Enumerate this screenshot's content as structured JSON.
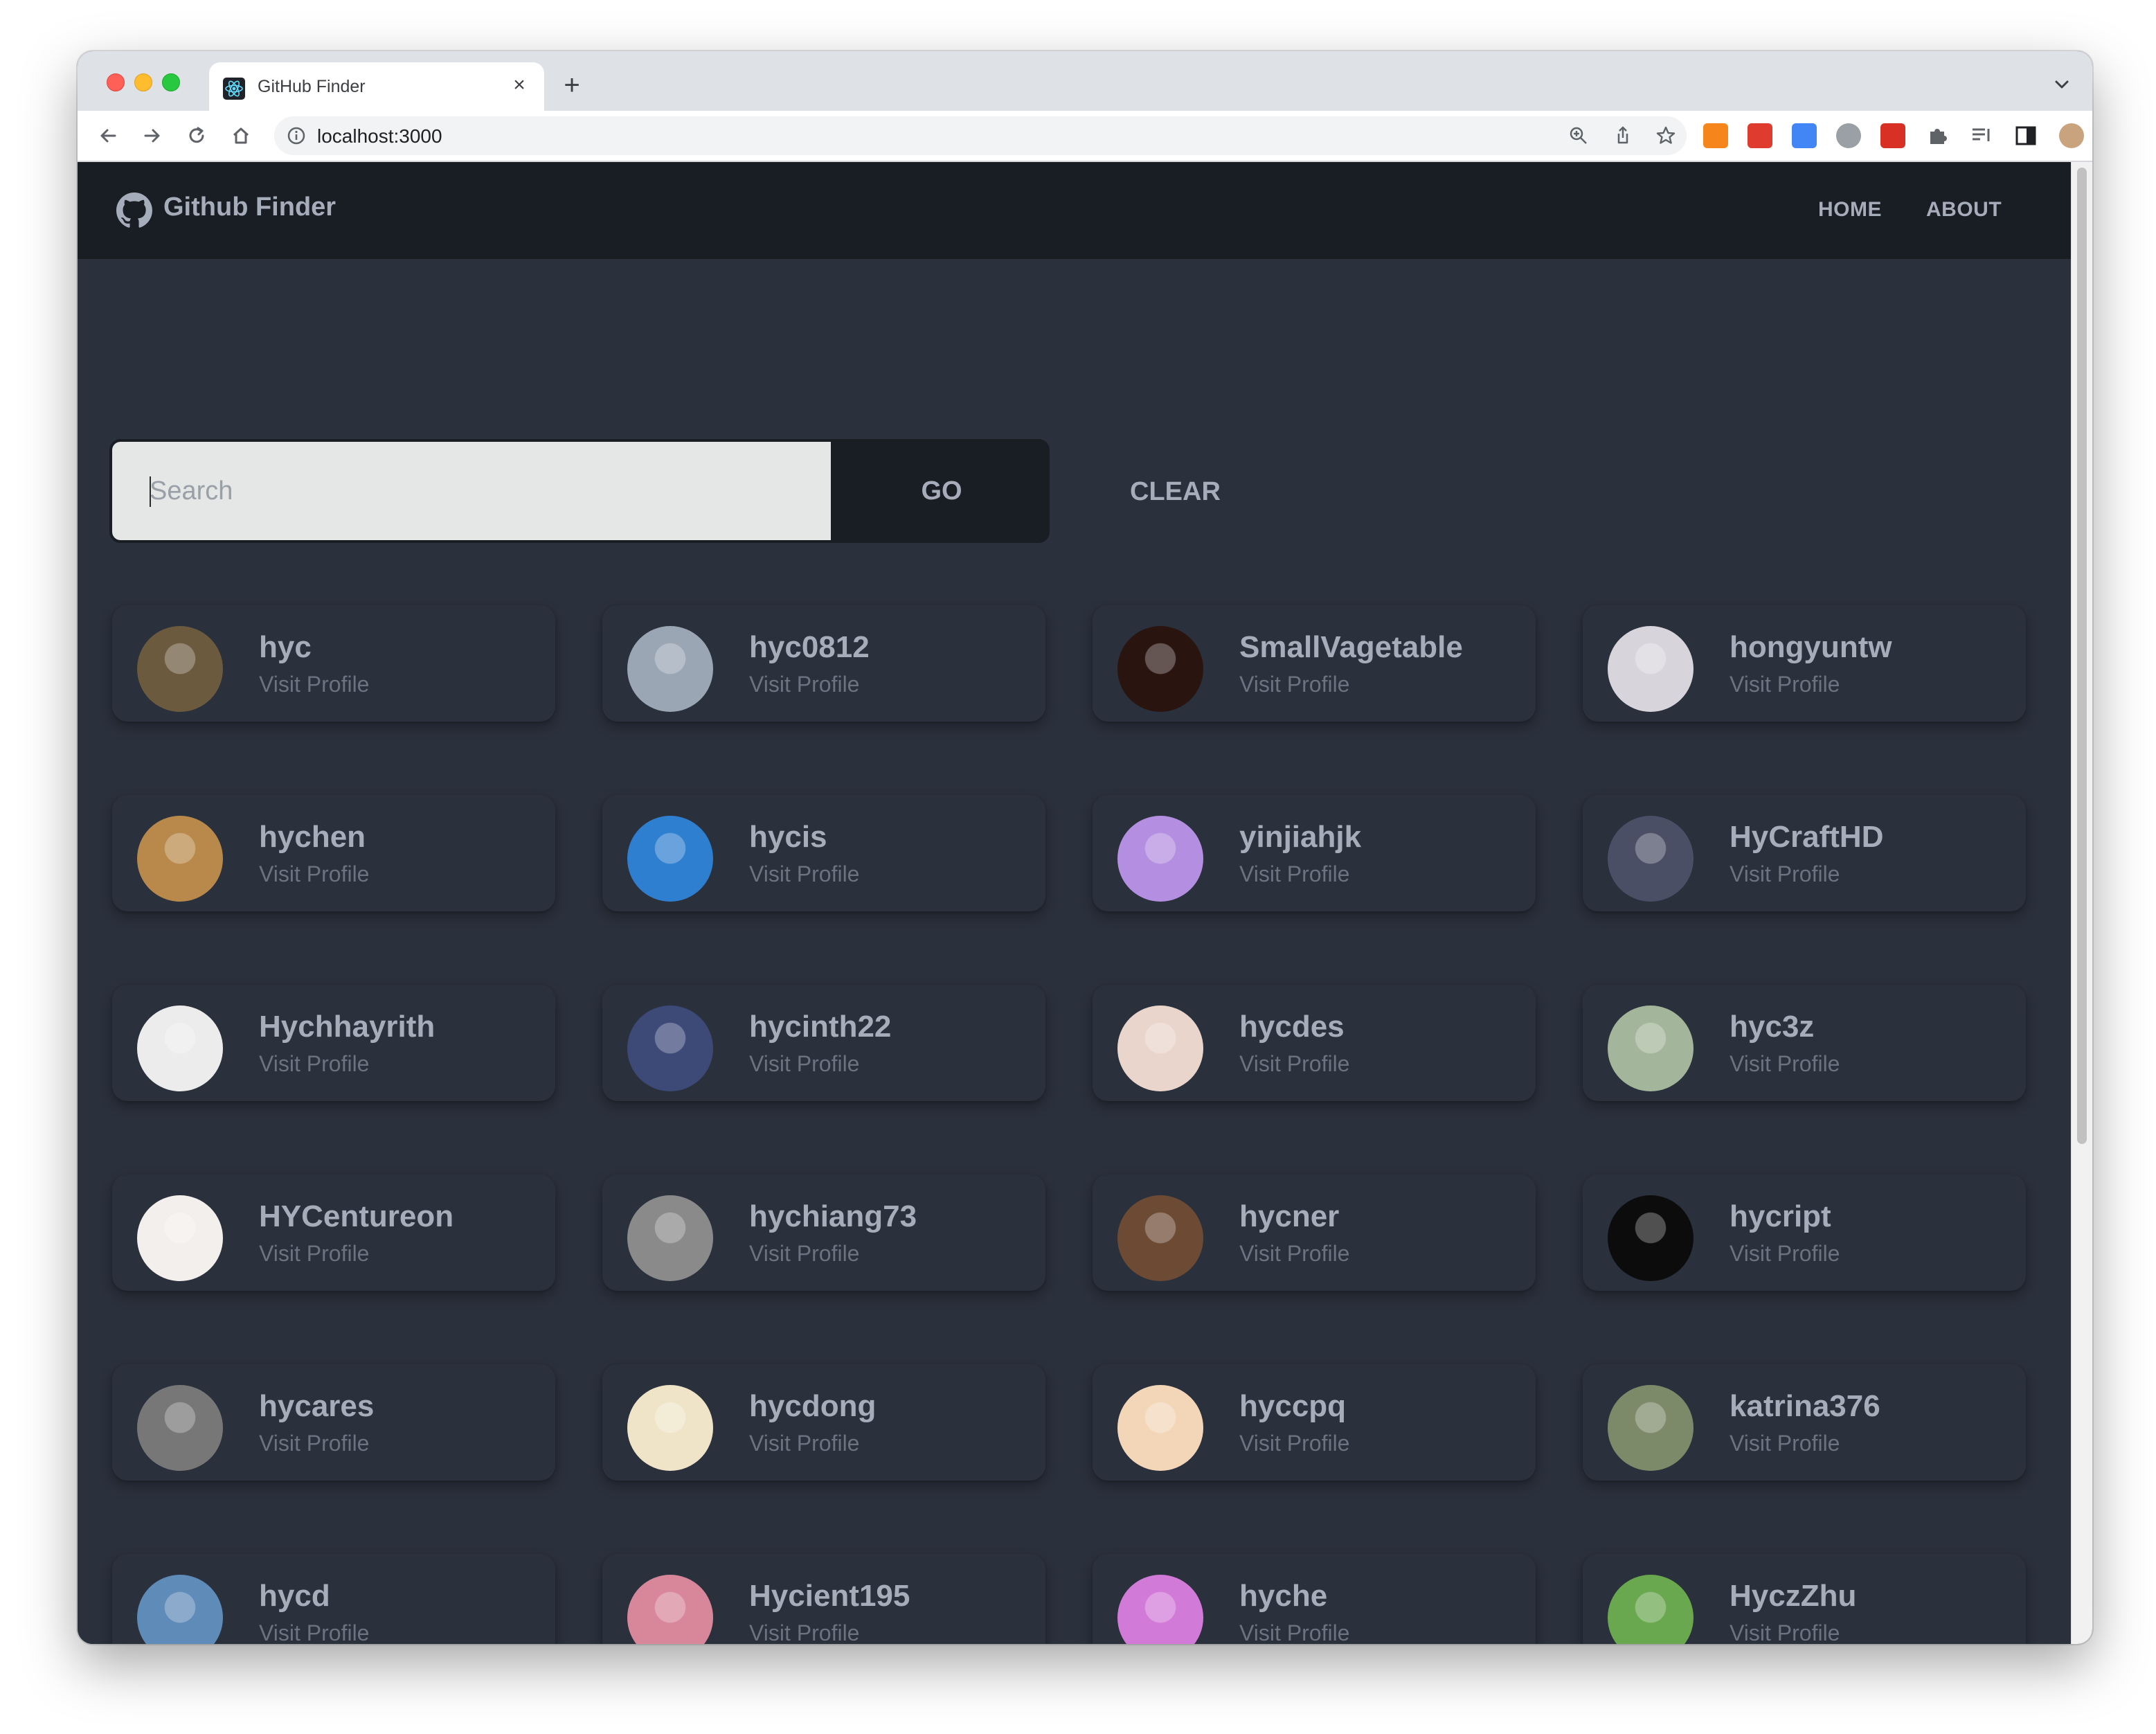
{
  "browser": {
    "tab_title": "GitHub Finder",
    "url": "localhost:3000",
    "new_tab_symbol": "+",
    "close_symbol": "×"
  },
  "navbar": {
    "brand": "Github Finder",
    "links": [
      "HOME",
      "ABOUT"
    ]
  },
  "search": {
    "placeholder": "Search",
    "value": "",
    "go_label": "GO",
    "clear_label": "CLEAR"
  },
  "users": [
    {
      "login": "hyc",
      "link": "Visit Profile",
      "avatar_color": "#6b5a3e"
    },
    {
      "login": "hyc0812",
      "link": "Visit Profile",
      "avatar_color": "#9aa6b4"
    },
    {
      "login": "SmallVagetable",
      "link": "Visit Profile",
      "avatar_color": "#2a1410"
    },
    {
      "login": "hongyuntw",
      "link": "Visit Profile",
      "avatar_color": "#d8d4dc"
    },
    {
      "login": "hychen",
      "link": "Visit Profile",
      "avatar_color": "#b8894a"
    },
    {
      "login": "hycis",
      "link": "Visit Profile",
      "avatar_color": "#2f7fd0"
    },
    {
      "login": "yinjiahjk",
      "link": "Visit Profile",
      "avatar_color": "#b48ee0"
    },
    {
      "login": "HyCraftHD",
      "link": "Visit Profile",
      "avatar_color": "#4a4f66"
    },
    {
      "login": "Hychhayrith",
      "link": "Visit Profile",
      "avatar_color": "#ececec"
    },
    {
      "login": "hycinth22",
      "link": "Visit Profile",
      "avatar_color": "#3d4a78"
    },
    {
      "login": "hycdes",
      "link": "Visit Profile",
      "avatar_color": "#e9d5cc"
    },
    {
      "login": "hyc3z",
      "link": "Visit Profile",
      "avatar_color": "#a3b59a"
    },
    {
      "login": "HYCentureon",
      "link": "Visit Profile",
      "avatar_color": "#f2efec"
    },
    {
      "login": "hychiang73",
      "link": "Visit Profile",
      "avatar_color": "#8a8a8a"
    },
    {
      "login": "hycner",
      "link": "Visit Profile",
      "avatar_color": "#6d4a34"
    },
    {
      "login": "hycript",
      "link": "Visit Profile",
      "avatar_color": "#0c0c0c"
    },
    {
      "login": "hycares",
      "link": "Visit Profile",
      "avatar_color": "#777777"
    },
    {
      "login": "hycdong",
      "link": "Visit Profile",
      "avatar_color": "#efe4c8"
    },
    {
      "login": "hyccpq",
      "link": "Visit Profile",
      "avatar_color": "#f3d6b8"
    },
    {
      "login": "katrina376",
      "link": "Visit Profile",
      "avatar_color": "#7c8a6a"
    },
    {
      "login": "hycd",
      "link": "Visit Profile",
      "avatar_color": "#5f8bb8"
    },
    {
      "login": "Hycient195",
      "link": "Visit Profile",
      "avatar_color": "#d8879a"
    },
    {
      "login": "hyche",
      "link": "Visit Profile",
      "avatar_color": "#d27ad8"
    },
    {
      "login": "HyczZhu",
      "link": "Visit Profile",
      "avatar_color": "#6aa84f"
    }
  ],
  "colors": {
    "navbar_bg": "#191d24",
    "page_bg": "#2a303c",
    "text": "#a6adba",
    "muted": "#6b7280",
    "input_bg": "#e5e6e6"
  }
}
